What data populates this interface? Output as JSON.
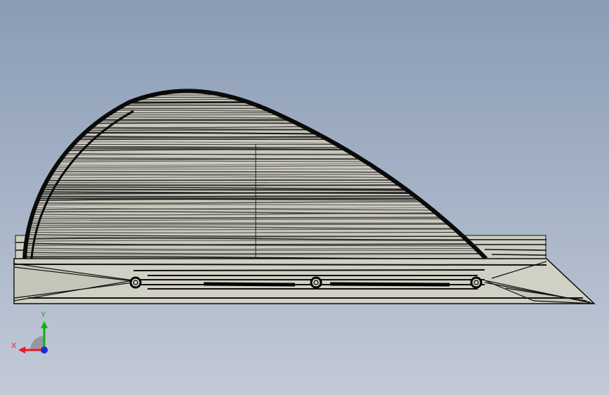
{
  "axis_triad": {
    "x_label": "X",
    "y_label": "Y",
    "colors": {
      "x": "#e8182c",
      "y": "#12b012",
      "z": "#1a2bd6"
    }
  },
  "model": {
    "face_color": "#d1d0c4",
    "edge_color": "#0d0d0d",
    "fastener_holes": 3,
    "icons": [
      "fastener-hole-icon"
    ]
  }
}
